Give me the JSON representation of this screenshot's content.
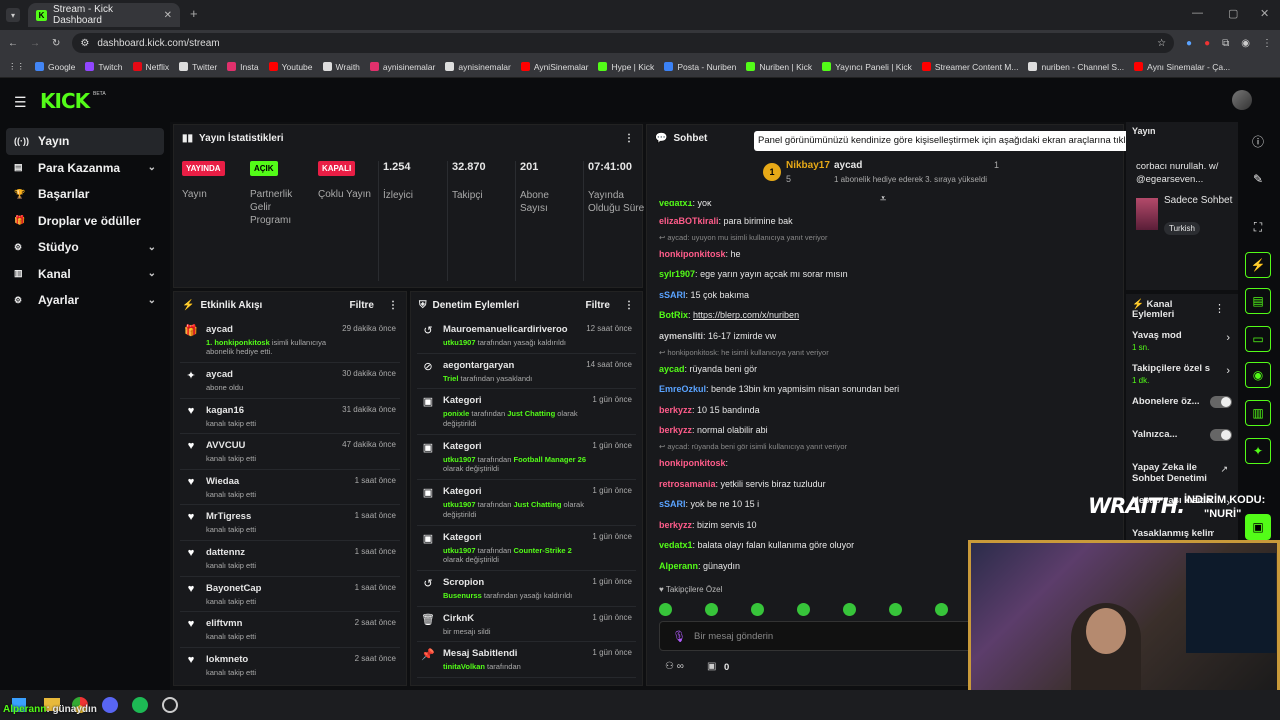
{
  "browser": {
    "tab_title": "Stream - Kick Dashboard",
    "url": "dashboard.kick.com/stream",
    "bookmarks": [
      "Google",
      "Twitch",
      "Netflix",
      "Twitter",
      "Insta",
      "Youtube",
      "Wraith",
      "aynisinemalar",
      "aynisinemalar",
      "AyniSinemalar",
      "Hype | Kick",
      "Posta - Nuriben",
      "Nuriben | Kick",
      "Yayıncı Paneli | Kick",
      "Streamer Content M...",
      "nuriben - Channel S...",
      "Aynı Sinemalar - Ça..."
    ]
  },
  "brand": {
    "logo": "KICK",
    "beta": "BETA",
    "accent": "#53fc18"
  },
  "sidebar": {
    "items": [
      {
        "label": "Yayın",
        "icon": "broadcast-icon"
      },
      {
        "label": "Para Kazanma",
        "icon": "money-icon",
        "expand": true
      },
      {
        "label": "Başarılar",
        "icon": "trophy-icon"
      },
      {
        "label": "Droplar ve ödüller",
        "icon": "gift-icon"
      },
      {
        "label": "Stüdyo",
        "icon": "studio-icon",
        "expand": true
      },
      {
        "label": "Kanal",
        "icon": "channel-icon",
        "expand": true
      },
      {
        "label": "Ayarlar",
        "icon": "gear-icon",
        "expand": true
      }
    ]
  },
  "stats": {
    "title": "Yayın İstatistikleri",
    "items": [
      {
        "badge": "YAYINDA",
        "label": "Yayın"
      },
      {
        "badge": "AÇIK",
        "label": "Partnerlik Gelir Programı"
      },
      {
        "badge": "KAPALI",
        "label": "Çoklu Yayın"
      },
      {
        "value": "1.254",
        "label": "İzleyici"
      },
      {
        "value": "32.870",
        "label": "Takipçi"
      },
      {
        "value": "201",
        "label": "Abone Sayısı"
      },
      {
        "value": "07:41:00",
        "label": "Yayında Olduğu Süre"
      }
    ]
  },
  "activity": {
    "title": "Etkinlik Akışı",
    "filter": "Filtre",
    "items": [
      {
        "user": "aycad",
        "sub_user": "1. honkiponkitosk",
        "sub": "isimli kullanıcıya abonelik hediye etti.",
        "time": "29 dakika önce",
        "icon": "gift-icon"
      },
      {
        "user": "aycad",
        "sub": "abone oldu",
        "time": "30 dakika önce",
        "icon": "star-icon"
      },
      {
        "user": "kagan16",
        "sub": "kanalı takip etti",
        "time": "31 dakika önce",
        "icon": "heart-icon"
      },
      {
        "user": "AVVCUU",
        "sub": "kanalı takip etti",
        "time": "47 dakika önce",
        "icon": "heart-icon"
      },
      {
        "user": "Wiedaa",
        "sub": "kanalı takip etti",
        "time": "1 saat önce",
        "icon": "heart-icon"
      },
      {
        "user": "MrTigress",
        "sub": "kanalı takip etti",
        "time": "1 saat önce",
        "icon": "heart-icon"
      },
      {
        "user": "dattennz",
        "sub": "kanalı takip etti",
        "time": "1 saat önce",
        "icon": "heart-icon"
      },
      {
        "user": "BayonetCap",
        "sub": "kanalı takip etti",
        "time": "1 saat önce",
        "icon": "heart-icon"
      },
      {
        "user": "eliftvmn",
        "sub": "kanalı takip etti",
        "time": "2 saat önce",
        "icon": "heart-icon"
      },
      {
        "user": "lokmneto",
        "sub": "kanalı takip etti",
        "time": "2 saat önce",
        "icon": "heart-icon"
      }
    ]
  },
  "moderation": {
    "title": "Denetim Eylemleri",
    "filter": "Filtre",
    "items": [
      {
        "title": "Mauroemanuelicardiriveroo",
        "by": "utku1907",
        "text": "tarafından yasağı kaldırıldı",
        "time": "12 saat önce",
        "icon": "undo-icon"
      },
      {
        "title": "aegontargaryan",
        "by": "Triel",
        "text": "tarafından yasaklandı",
        "time": "14 saat önce",
        "icon": "ban-icon"
      },
      {
        "title": "Kategori",
        "by": "ponixle",
        "text": "tarafından",
        "extra": "Just Chatting",
        "tail": "olarak değiştirildi",
        "time": "1 gün önce",
        "icon": "category-icon"
      },
      {
        "title": "Kategori",
        "by": "utku1907",
        "text": "tarafından",
        "extra": "Football Manager 26",
        "tail": "olarak değiştirildi",
        "time": "1 gün önce",
        "icon": "category-icon"
      },
      {
        "title": "Kategori",
        "by": "utku1907",
        "text": "tarafından",
        "extra": "Just Chatting",
        "tail": "olarak değiştirildi",
        "time": "1 gün önce",
        "icon": "category-icon"
      },
      {
        "title": "Kategori",
        "by": "utku1907",
        "text": "tarafından",
        "extra": "Counter-Strike 2",
        "tail": "olarak değiştirildi",
        "time": "1 gün önce",
        "icon": "category-icon"
      },
      {
        "title": "Scropion",
        "by": "Busenurss",
        "text": "tarafından yasağı kaldırıldı",
        "time": "1 gün önce",
        "icon": "undo-icon"
      },
      {
        "title": "CirknK",
        "text": "bir mesajı sildi",
        "time": "1 gün önce",
        "icon": "trash-icon"
      },
      {
        "title": "Mesaj Sabitlendi",
        "by": "tinitaVolkan",
        "text": "tarafından",
        "time": "1 gün önce",
        "icon": "pin-icon"
      }
    ]
  },
  "chat": {
    "title": "Sohbet",
    "tooltip": "Panel görünümünüzü kendinize göre kişiselleştirmek için aşağıdaki ekran araçlarına tıklayın veya sürükleyin",
    "pinned": {
      "user1": "Nikbay17",
      "count1": "5",
      "user2": "aycad",
      "count2": "1",
      "text": "1 abonelik hediye ederek 3. sıraya yükseldi"
    },
    "messages": [
      {
        "type": "msg",
        "user": "vedatx1",
        "color": "#53fc18",
        "text": "yok"
      },
      {
        "type": "msg",
        "user": "elizaBOTkirali",
        "color": "#ff5c8a",
        "text": "para birimine bak"
      },
      {
        "type": "reply",
        "text": "aycad: uyuyon mu isimli kullanıcıya yanıt veriyor"
      },
      {
        "type": "msg",
        "user": "honkiponkitosk",
        "color": "#ff5c8a",
        "text": "he"
      },
      {
        "type": "msg",
        "user": "sylr1907",
        "color": "#53fc18",
        "text": "ege yarın yayın açcak mı sorar mısın"
      },
      {
        "type": "msg",
        "user": "sSARI",
        "color": "#5aa3ff",
        "text": "15 çok bakıma"
      },
      {
        "type": "msg",
        "user": "BotRix",
        "color": "#53fc18",
        "text": "https://blerp.com/x/nuriben"
      },
      {
        "type": "msg",
        "user": "aymensliti",
        "color": "#cccccc",
        "text": "16-17 izmirde vw"
      },
      {
        "type": "reply",
        "text": "honkiponkitosk: he isimli kullanıcıya yanıt veriyor"
      },
      {
        "type": "msg",
        "user": "aycad",
        "color": "#53fc18",
        "text": "rüyanda beni gör"
      },
      {
        "type": "msg",
        "user": "EmreOzkul",
        "color": "#5aa3ff",
        "text": "bende 13bin km yapmisim nisan sonundan beri"
      },
      {
        "type": "msg",
        "user": "berkyzz",
        "color": "#ff5c8a",
        "text": "10 15 bandında"
      },
      {
        "type": "msg",
        "user": "berkyzz",
        "color": "#ff5c8a",
        "text": "normal olabilir abi"
      },
      {
        "type": "reply",
        "text": "aycad: rüyanda beni gör isimli kullanıcıya yanıt veriyor"
      },
      {
        "type": "msg",
        "user": "honkiponkitosk",
        "color": "#ff5c8a",
        "text": ""
      },
      {
        "type": "msg",
        "user": "retrosamania",
        "color": "#ff5c8a",
        "text": "yetkili servis biraz tuzludur"
      },
      {
        "type": "msg",
        "user": "sSARI",
        "color": "#5aa3ff",
        "text": "yok be ne 10 15 i"
      },
      {
        "type": "msg",
        "user": "berkyzz",
        "color": "#ff5c8a",
        "text": "bizim servis 10"
      },
      {
        "type": "msg",
        "user": "vedatx1",
        "color": "#53fc18",
        "text": "balata olayı falan kullanıma göre oluyor"
      },
      {
        "type": "msg",
        "user": "Alperann",
        "color": "#53fc18",
        "text": "günaydın"
      }
    ],
    "followers_only": "Takipçilere Özel",
    "input_placeholder": "Bir mesaj gönderin",
    "footer_count": "0"
  },
  "right_panel": {
    "top_title": "Yayın",
    "top_text": "corbacı nurullah. w/ @egearseven...",
    "mode": "Sadece Sohbet",
    "language": "Turkish",
    "actions_title": "Kanal Eylemleri",
    "actions": [
      {
        "label": "Yavaş mod",
        "sub": "1 sn.",
        "kind": "chevron"
      },
      {
        "label": "Takipçilere özel s",
        "sub": "1 dk.",
        "kind": "chevron"
      },
      {
        "label": "Abonelere öz...",
        "kind": "toggle"
      },
      {
        "label": "Yalnızca...",
        "kind": "toggle"
      },
      {
        "label": "Yapay Zeka ile Sohbet Denetimi",
        "kind": "link"
      },
      {
        "label": "Hesap yaşı kısıtla",
        "kind": "chevron"
      },
      {
        "label": "Yasaklanmış kelim",
        "kind": "none"
      }
    ]
  },
  "overlay": {
    "brand": "WRAITH.",
    "code_label": "İNDİRİM KODU:",
    "code": "\"NURİ\""
  },
  "taskbar": {
    "caption_user": "Alperann",
    "caption_text": ": günaydın"
  }
}
